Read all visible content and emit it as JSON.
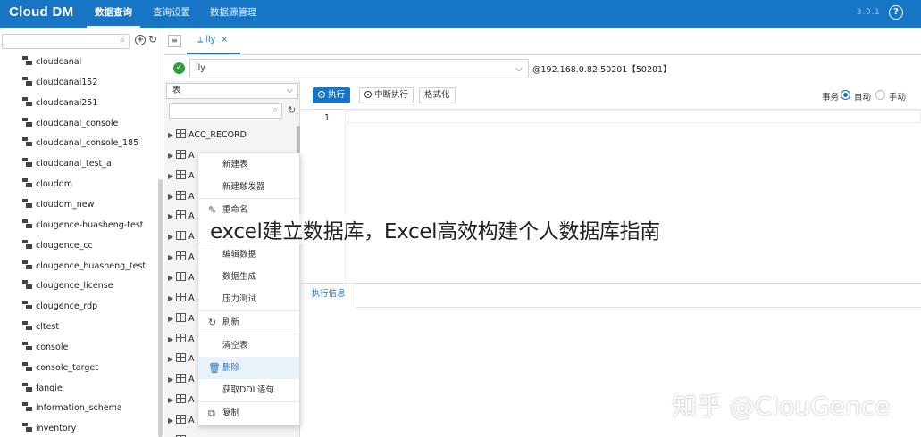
{
  "app": {
    "logo": "Cloud DM",
    "nav": [
      "数据查询",
      "查询设置",
      "数据源管理"
    ],
    "version": "3.0.1",
    "help": "?"
  },
  "left_panel": {
    "databases": [
      "cloudcanal",
      "cloudcanal152",
      "cloudcanal251",
      "cloudcanal_console",
      "cloudcanal_console_185",
      "cloudcanal_test_a",
      "clouddm",
      "clouddm_new",
      "clougence-huasheng-test",
      "clougence_cc",
      "clougence_huasheng_test",
      "clougence_license",
      "clougence_rdp",
      "cltest",
      "console",
      "console_target",
      "fanqie",
      "information_schema",
      "inventory"
    ]
  },
  "tab": {
    "label": "lly",
    "close": "×"
  },
  "connection": {
    "database": "lly",
    "info": "@192.168.0.82:50201【50201】"
  },
  "object_panel": {
    "type": "表",
    "rows": [
      "ACC_RECORD",
      "A",
      "A",
      "A",
      "A",
      "A",
      "A",
      "A",
      "A",
      "A",
      "A",
      "A",
      "A",
      "A",
      "A",
      "A"
    ]
  },
  "context_menu": {
    "items": [
      "新建表",
      "新建触发器",
      "重命名",
      "编辑数据",
      "数据生成",
      "压力测试",
      "刷新",
      "清空表",
      "删除",
      "获取DDL语句",
      "复制"
    ]
  },
  "toolbar": {
    "execute": "执行",
    "interrupt": "中断执行",
    "format": "格式化",
    "transaction": "事务",
    "auto": "自动",
    "manual": "手动"
  },
  "editor": {
    "line": "1"
  },
  "exec_panel": {
    "tab": "执行信息"
  },
  "overlay": {
    "caption": "excel建立数据库，Excel高效构建个人数据库指南",
    "watermark": "知乎 @ClouGence"
  }
}
